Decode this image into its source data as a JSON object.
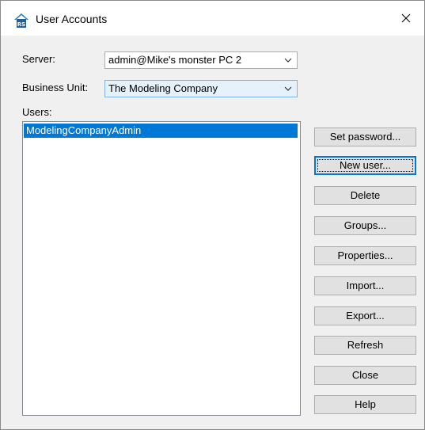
{
  "window": {
    "title": "User Accounts"
  },
  "icons": {
    "app": "rs-app-icon",
    "close": "close-icon",
    "dropdown": "chevron-down-icon"
  },
  "form": {
    "server_label": "Server:",
    "server_value": "admin@Mike's monster PC 2",
    "unit_label": "Business Unit:",
    "unit_value": "The Modeling Company",
    "users_label": "Users:"
  },
  "users": [
    "ModelingCompanyAdmin"
  ],
  "buttons": {
    "set_password": "Set password...",
    "new_user": "New user...",
    "delete": "Delete",
    "groups": "Groups...",
    "properties": "Properties...",
    "import": "Import...",
    "export": "Export...",
    "refresh": "Refresh",
    "close": "Close",
    "help": "Help"
  },
  "colors": {
    "selection": "#0078d7",
    "dialog_bg": "#f0f0f0",
    "button_bg": "#e1e1e1"
  }
}
